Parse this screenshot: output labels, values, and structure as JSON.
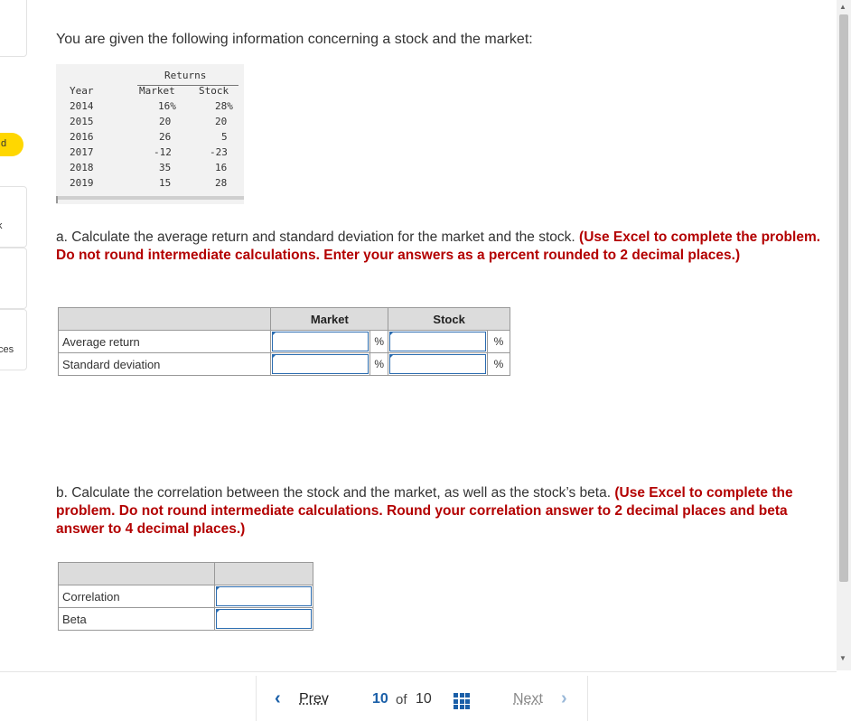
{
  "sidebar": {
    "pill_text": "d",
    "item2_text": "k",
    "item3_text": "ces"
  },
  "intro": "You are given the following information concerning a stock and the market:",
  "returns_table": {
    "group_header": "Returns",
    "col_year": "Year",
    "col_market": "Market",
    "col_stock": "Stock",
    "rows": [
      {
        "year": "2014",
        "market": "16%",
        "stock": "28%"
      },
      {
        "year": "2015",
        "market": "20",
        "stock": "20"
      },
      {
        "year": "2016",
        "market": "26",
        "stock": "5"
      },
      {
        "year": "2017",
        "market": "-12",
        "stock": "-23"
      },
      {
        "year": "2018",
        "market": "35",
        "stock": "16"
      },
      {
        "year": "2019",
        "market": "15",
        "stock": "28"
      }
    ]
  },
  "part_a": {
    "text": "a. Calculate the average return and standard deviation for the market and the stock.",
    "instruction": "(Use Excel to complete the problem. Do not round intermediate calculations. Enter your answers as a percent rounded to 2 decimal places.)",
    "col_market": "Market",
    "col_stock": "Stock",
    "row_avg": "Average return",
    "row_std": "Standard deviation",
    "unit": "%"
  },
  "part_b": {
    "text": "b. Calculate the correlation between the stock and the market, as well as the stock’s beta.",
    "instruction": "(Use Excel to complete the problem. Do not round intermediate calculations. Round your correlation answer to 2 decimal places and beta answer to 4 decimal places.)",
    "row_corr": "Correlation",
    "row_beta": "Beta"
  },
  "footer": {
    "prev": "Prev",
    "current": "10",
    "of": "of",
    "total": "10",
    "next": "Next"
  }
}
